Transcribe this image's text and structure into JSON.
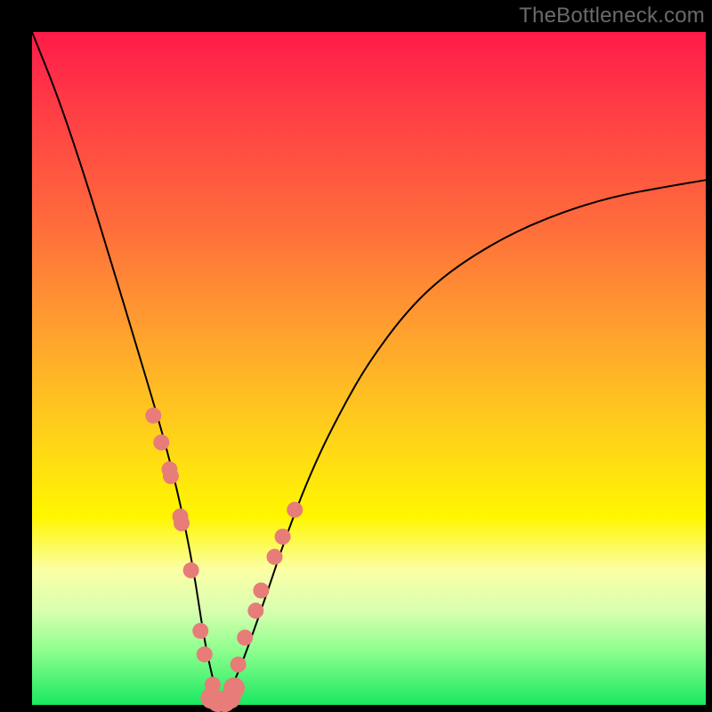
{
  "watermark": {
    "text": "TheBottleneck.com"
  },
  "colors": {
    "curve": "#000000",
    "marker_fill": "#e77c79",
    "marker_stroke": "#cf5a57",
    "background_black": "#000000"
  },
  "chart_data": {
    "type": "line",
    "title": "",
    "xlabel": "",
    "ylabel": "",
    "xlim": [
      0,
      100
    ],
    "ylim": [
      0,
      100
    ],
    "grid": false,
    "legend": false,
    "series": [
      {
        "name": "bottleneck-curve",
        "kind": "line",
        "x": [
          0,
          4,
          8,
          12,
          15,
          18,
          20,
          22,
          24,
          25.5,
          27,
          28,
          30,
          34,
          38,
          42,
          46,
          50,
          56,
          62,
          70,
          78,
          86,
          94,
          100
        ],
        "y": [
          100,
          90,
          78,
          65,
          55,
          45,
          38,
          30,
          20,
          10,
          3,
          0.5,
          3,
          14,
          26,
          36,
          44,
          51,
          59,
          64.5,
          69.5,
          73,
          75.5,
          77,
          78
        ]
      },
      {
        "name": "left-branch-markers",
        "kind": "scatter",
        "x": [
          18.0,
          19.2,
          20.4,
          20.6,
          22.0,
          22.2,
          23.6,
          25.0,
          25.6,
          26.8
        ],
        "y": [
          43.0,
          39.0,
          35.0,
          34.0,
          28.0,
          27.0,
          20.0,
          11.0,
          7.5,
          3.0
        ]
      },
      {
        "name": "right-branch-markers",
        "kind": "scatter",
        "x": [
          30.6,
          31.6,
          33.2,
          34.0,
          36.0,
          37.2,
          39.0
        ],
        "y": [
          6.0,
          10.0,
          14.0,
          17.0,
          22.0,
          25.0,
          29.0
        ]
      },
      {
        "name": "trough-thick-markers",
        "kind": "scatter",
        "x": [
          26.6,
          27.6,
          28.6,
          29.4,
          30.0
        ],
        "y": [
          1.0,
          0.5,
          0.5,
          1.0,
          2.5
        ]
      }
    ]
  }
}
